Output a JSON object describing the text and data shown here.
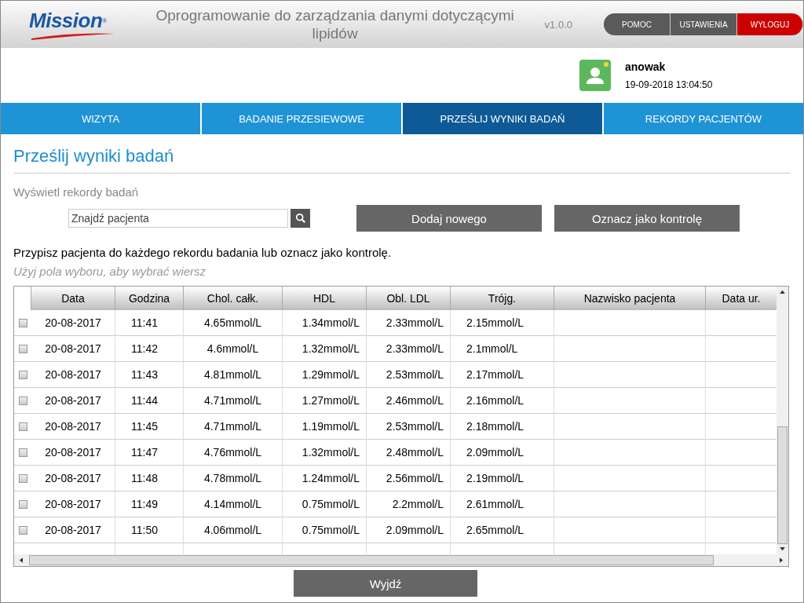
{
  "header": {
    "logo": "Mission",
    "logo_mark": "®",
    "title": "Oprogramowanie do zarządzania danymi dotyczącymi lipidów",
    "version": "v1.0.0",
    "buttons": [
      {
        "label": "POMOC",
        "kind": "normal"
      },
      {
        "label": "USTAWIENIA",
        "kind": "normal"
      },
      {
        "label": "WYLOGUJ",
        "kind": "danger"
      }
    ]
  },
  "user": {
    "name": "anowak",
    "datetime": "19-09-2018 13:04:50"
  },
  "tabs": [
    {
      "label": "WIZYTA",
      "selected": false
    },
    {
      "label": "BADANIE PRZESIEWOWE",
      "selected": false
    },
    {
      "label": "PRZEŚLIJ WYNIKI BADAŃ",
      "selected": true
    },
    {
      "label": "REKORDY PACJENTÓW",
      "selected": false
    }
  ],
  "page_title": "Prześlij wyniki badań",
  "section_label": "Wyświetl rekordy badań",
  "search": {
    "placeholder": "Znajdź pacjenta"
  },
  "actions": [
    "Dodaj nowego",
    "Oznacz jako kontrolę"
  ],
  "instruction": "Przypisz pacjenta do każdego rekordu badania lub oznacz jako kontrolę.",
  "hint": "Użyj pola wyboru, aby wybrać wiersz",
  "table": {
    "columns": [
      "Data",
      "Godzina",
      "Chol. całk.",
      "HDL",
      "Obl. LDL",
      "Trójg.",
      "Nazwisko pacjenta",
      "Data ur."
    ],
    "rows": [
      {
        "checked": false,
        "cells": [
          "20-08-2017",
          "11:41",
          "4.65mmol/L",
          "1.34mmol/L",
          "2.33mmol/L",
          "2.15mmol/L"
        ]
      },
      {
        "checked": false,
        "cells": [
          "20-08-2017",
          "11:42",
          "4.6mmol/L",
          "1.32mmol/L",
          "2.33mmol/L",
          "2.1mmol/L"
        ]
      },
      {
        "checked": false,
        "cells": [
          "20-08-2017",
          "11:43",
          "4.81mmol/L",
          "1.29mmol/L",
          "2.53mmol/L",
          "2.17mmol/L"
        ]
      },
      {
        "checked": false,
        "cells": [
          "20-08-2017",
          "11:44",
          "4.71mmol/L",
          "1.27mmol/L",
          "2.46mmol/L",
          "2.16mmol/L"
        ]
      },
      {
        "checked": false,
        "cells": [
          "20-08-2017",
          "11:45",
          "4.71mmol/L",
          "1.19mmol/L",
          "2.53mmol/L",
          "2.18mmol/L"
        ]
      },
      {
        "checked": false,
        "cells": [
          "20-08-2017",
          "11:47",
          "4.76mmol/L",
          "1.32mmol/L",
          "2.48mmol/L",
          "2.09mmol/L"
        ]
      },
      {
        "checked": false,
        "cells": [
          "20-08-2017",
          "11:48",
          "4.78mmol/L",
          "1.24mmol/L",
          "2.56mmol/L",
          "2.19mmol/L"
        ]
      },
      {
        "checked": false,
        "cells": [
          "20-08-2017",
          "11:49",
          "4.14mmol/L",
          "0.75mmol/L",
          "2.2mmol/L",
          "2.61mmol/L"
        ]
      },
      {
        "checked": false,
        "cells": [
          "20-08-2017",
          "11:50",
          "4.06mmol/L",
          "0.75mmol/L",
          "2.09mmol/L",
          "2.65mmol/L"
        ]
      }
    ]
  },
  "exit_button": "Wyjdź"
}
